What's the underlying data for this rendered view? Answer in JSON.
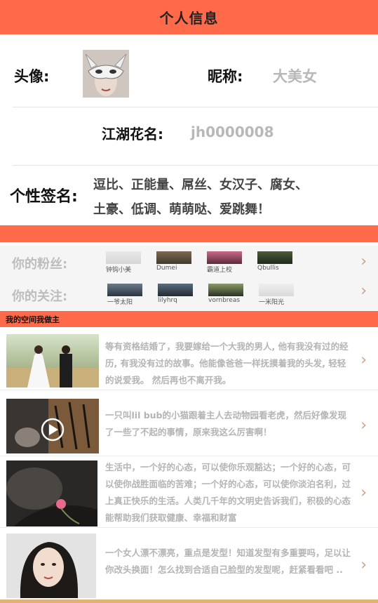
{
  "header": {
    "title": "个人信息"
  },
  "profile": {
    "avatar_label": "头像:",
    "nickname_label": "昵称:",
    "nickname_value": "大美女",
    "alias_label": "江湖花名:",
    "alias_value": "jh0000008",
    "signature_label": "个性签名:",
    "signature_line1": "逗比、正能量、屌丝、女汉子、腐女、",
    "signature_line2": "土豪、低调、萌萌哒、爱跳舞！"
  },
  "social": {
    "fans_label": "你的粉丝:",
    "follow_label": "你的关注:",
    "fans": [
      {
        "caption": "钟钩小美"
      },
      {
        "caption": "Dumei"
      },
      {
        "caption": "霸道上校"
      },
      {
        "caption": "Qbullis"
      }
    ],
    "following": [
      {
        "caption": "一爷太阳"
      },
      {
        "caption": "lilyhrq"
      },
      {
        "caption": "vornbreas"
      },
      {
        "caption": "一米阳光"
      }
    ]
  },
  "space": {
    "title": "我的空间我做主",
    "posts": [
      {
        "text": "等有资格结婚了，我要嫁给一个大我的男人, 他有我没有过的经历, 有我没有过的故事。他能像爸爸一样抚摸着我的头发, 轻轻的说爱我。 然后再也不离开我。"
      },
      {
        "text": "一只叫lil bub的小猫跟着主人去动物园看老虎，然后好像发现了一些了不起的事情，原来我这么厉害啊！"
      },
      {
        "text": "生活中，一个好的心态，可以使你乐观豁达；一个好的心态，可以使你战胜面临的苦难；一个好的心态，可以使你淡泊名利，过上真正快乐的生活。人类几千年的文明史告诉我们，积极的心态能帮助我们获取健康、幸福和财富"
      },
      {
        "text": "一个女人漂不漂亮，重点是发型！知道发型有多重要吗，足以让你改头换面！怎么找到合适自己脸型的发型呢，赶紧看看吧 .."
      }
    ]
  },
  "icons": {
    "chevron": "chevron-right-icon",
    "play": "play-icon"
  },
  "colors": {
    "accent": "#ff6b4a",
    "muted_text": "#b4b4b4",
    "chevron": "#c9a389"
  }
}
